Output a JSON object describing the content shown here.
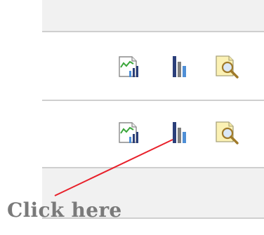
{
  "rows": [
    {
      "buttons": [
        {
          "icon": "line-chart-icon"
        },
        {
          "icon": "bar-chart-icon"
        },
        {
          "icon": "magnify-report-icon"
        }
      ]
    },
    {
      "buttons": [
        {
          "icon": "line-chart-icon"
        },
        {
          "icon": "bar-chart-icon",
          "highlighted": true
        },
        {
          "icon": "magnify-report-icon"
        }
      ]
    }
  ],
  "annotation": {
    "text": "Click here",
    "line_color": "#e8202a"
  },
  "colors": {
    "band": "#f1f1f1",
    "rule": "#cfcfcf",
    "bar_dark": "#2b3f7a",
    "bar_gray": "#7f7f7f",
    "bar_blue": "#4f8fd6",
    "line_green": "#3aa63a",
    "doc_yellow": "#fbf1b4"
  }
}
